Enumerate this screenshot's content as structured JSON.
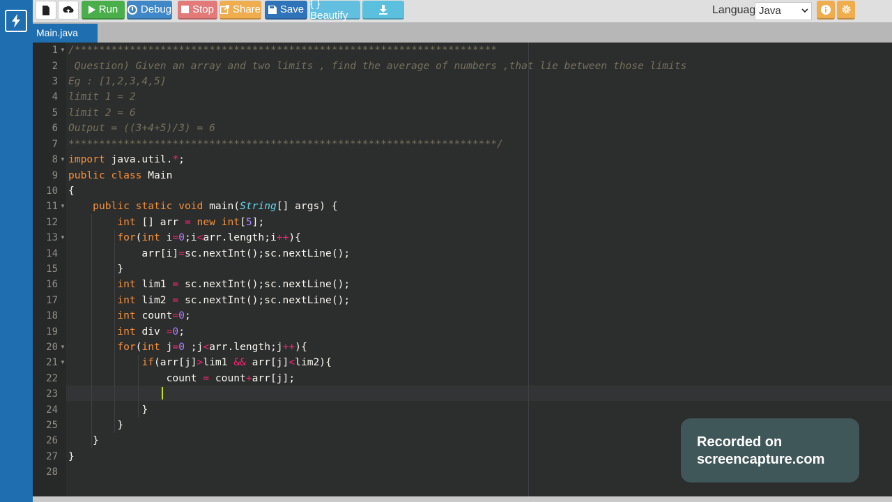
{
  "toolbar": {
    "run_label": "Run",
    "debug_label": "Debug",
    "stop_label": "Stop",
    "share_label": "Share",
    "save_label": "Save",
    "beautify_label": "{ } Beautify",
    "language_label": "Language",
    "language_value": "Java"
  },
  "colors": {
    "sidebar": "#1f6fb0",
    "run": "#4aaf4a",
    "debug": "#3f87c6",
    "stop": "#e27a7a",
    "share": "#f0ad4e",
    "save": "#2f73b8",
    "beautify": "#63bfe0",
    "download": "#5bc0de",
    "icons_orange": "#f0ad4e",
    "editor_bg": "#2c2d2d"
  },
  "tab": {
    "label": "Main.java"
  },
  "editor": {
    "line_numbers": [
      "1",
      "2",
      "3",
      "4",
      "5",
      "6",
      "7",
      "8",
      "9",
      "10",
      "11",
      "12",
      "13",
      "14",
      "15",
      "16",
      "17",
      "18",
      "19",
      "20",
      "21",
      "22",
      "23",
      "24",
      "25",
      "26",
      "27",
      "28"
    ],
    "lines": [
      "/*********************************************************************",
      " Question) Given an array and two limits , find the average of numbers ,that lie between those limits",
      "Eg : [1,2,3,4,5]",
      "limit 1 = 2",
      "limit 2 = 6",
      "Output = ((3+4+5)/3) = 6",
      "**********************************************************************/",
      "import java.util.*;",
      "public class Main",
      "{",
      "    public static void main(String[] args) {",
      "        int [] arr = new int[5];",
      "        for(int i=0;i<arr.length;i++){",
      "            arr[i]=sc.nextInt();sc.nextLine();",
      "        }",
      "        int lim1 = sc.nextInt();sc.nextLine();",
      "        int lim2 = sc.nextInt();sc.nextLine();",
      "        int count=0;",
      "        int div =0;",
      "        for(int j=0 ;j<arr.length;j++){",
      "            if(arr[j]>lim1 && arr[j]<lim2){",
      "                count = count+arr[j];",
      "                ",
      "            }",
      "        }",
      "    }",
      "}",
      ""
    ]
  },
  "watermark": {
    "line1": "Recorded on",
    "line2": "screencapture.com"
  }
}
